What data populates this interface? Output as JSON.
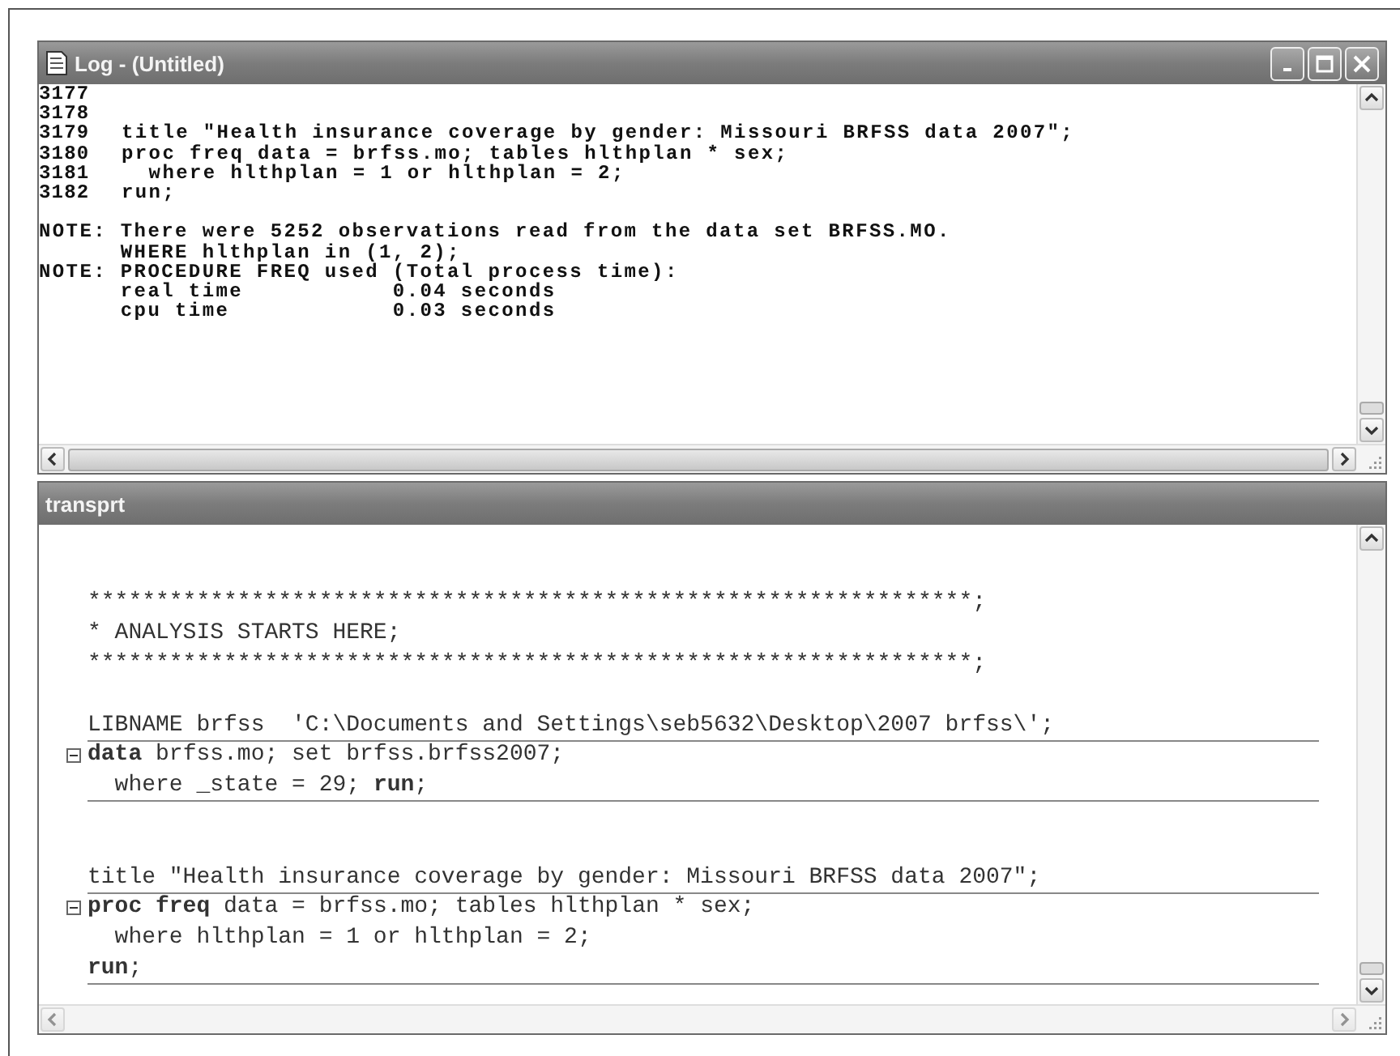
{
  "log_window": {
    "title": "Log - (Untitled)",
    "lines": [
      {
        "kind": "code",
        "number": "3177"
      },
      {
        "kind": "code",
        "number": "3178"
      },
      {
        "kind": "code",
        "number": "3179",
        "text": "title \"Health insurance coverage by gender: Missouri BRFSS data 2007\";"
      },
      {
        "kind": "code",
        "number": "3180",
        "text": "proc freq data = brfss.mo; tables hlthplan * sex;"
      },
      {
        "kind": "code",
        "number": "3181",
        "text": "  where hlthplan = 1 or hlthplan = 2;"
      },
      {
        "kind": "code",
        "number": "3182",
        "text": "run;"
      },
      {
        "kind": "blank"
      },
      {
        "kind": "note",
        "text": "NOTE: There were 5252 observations read from the data set BRFSS.MO."
      },
      {
        "kind": "note",
        "text": "      WHERE hlthplan in (1, 2);"
      },
      {
        "kind": "note",
        "text": "NOTE: PROCEDURE FREQ used (Total process time):"
      },
      {
        "kind": "note",
        "text": "      real time           0.04 seconds"
      },
      {
        "kind": "note",
        "text": "      cpu time            0.03 seconds"
      }
    ]
  },
  "editor_window": {
    "title": "transprt",
    "lines": [
      {
        "kind": "blank",
        "divider": false
      },
      {
        "kind": "blank",
        "divider": false
      },
      {
        "kind": "comment",
        "text": "*****************************************************************;",
        "divider": false
      },
      {
        "kind": "comment",
        "text": "* ANALYSIS STARTS HERE;",
        "divider": false
      },
      {
        "kind": "comment",
        "text": "*****************************************************************;",
        "divider": false
      },
      {
        "kind": "blank",
        "divider": false
      },
      {
        "kind": "code",
        "text": "LIBNAME brfss  'C:\\Documents and Settings\\seb5632\\Desktop\\2007 brfss\\';",
        "divider": true
      },
      {
        "kind": "block-start",
        "expanded": true,
        "text": "**data** brfss.mo; set brfss.brfss2007;",
        "divider": false
      },
      {
        "kind": "code",
        "text": "  where _state = 29; **run**;",
        "divider": true
      },
      {
        "kind": "blank",
        "divider": false
      },
      {
        "kind": "blank",
        "divider": false
      },
      {
        "kind": "code",
        "text": "title \"Health insurance coverage by gender: Missouri BRFSS data 2007\";",
        "divider": true
      },
      {
        "kind": "block-start",
        "expanded": true,
        "text": "**proc freq** data = brfss.mo; tables hlthplan * sex;",
        "divider": false
      },
      {
        "kind": "code",
        "text": "  where hlthplan = 1 or hlthplan = 2;",
        "divider": false
      },
      {
        "kind": "code",
        "text": "**run**;",
        "divider": true
      }
    ]
  }
}
